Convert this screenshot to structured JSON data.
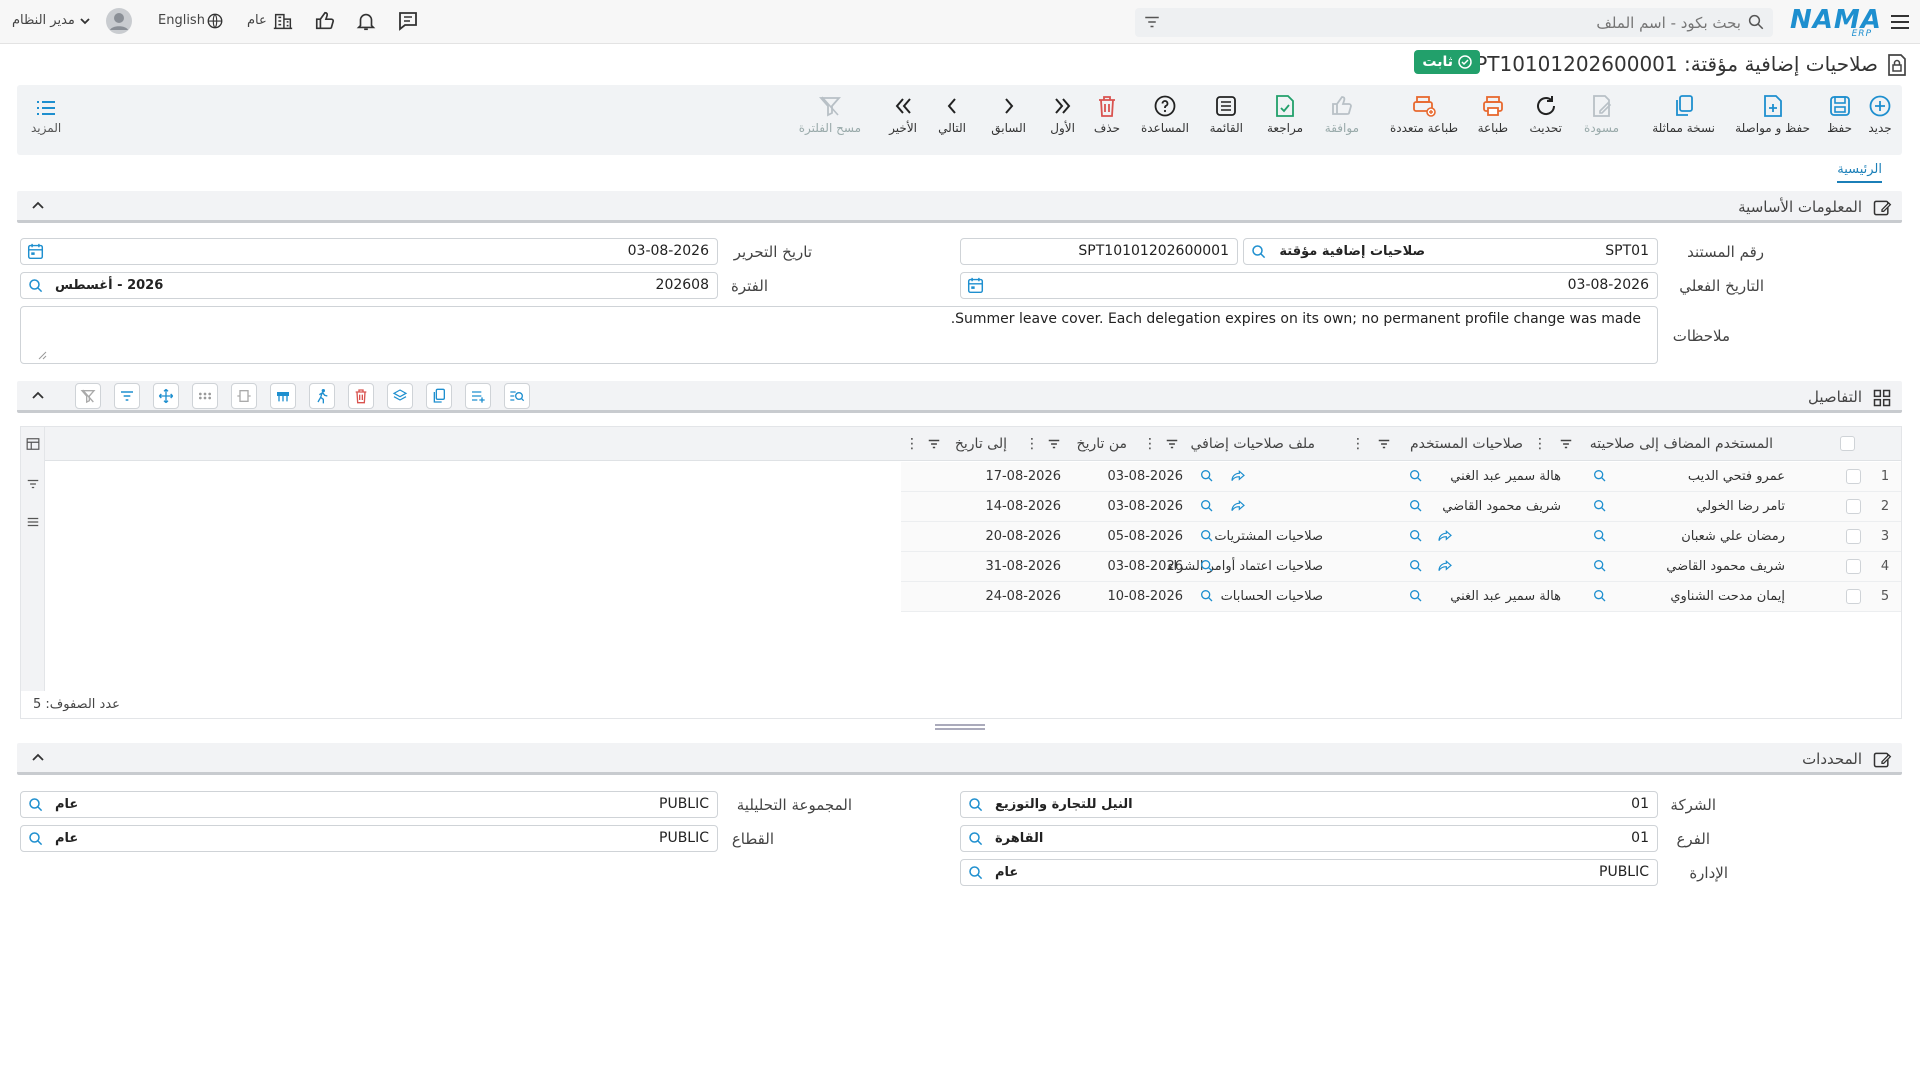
{
  "topbar": {
    "logo_text": "NAMA",
    "logo_sub": "ERP",
    "search_placeholder": "بحث بكود - اسم الملف",
    "user_name": "مدير النظام",
    "language": "English",
    "context": "عام"
  },
  "title": {
    "text": "صلاحيات إضافية مؤقتة: SPT10101202600001",
    "status": "ثابت"
  },
  "toolbar": {
    "buttons": [
      {
        "label": "جديد",
        "icon": "plus-circle-icon"
      },
      {
        "label": "حفظ",
        "icon": "save-icon"
      },
      {
        "label": "حفظ و مواصلة",
        "icon": "save-continue-icon"
      },
      {
        "label": "نسخة مماثلة",
        "icon": "copy-icon"
      },
      {
        "label": "مسودة",
        "icon": "draft-icon"
      },
      {
        "label": "تحديث",
        "icon": "refresh-icon"
      },
      {
        "label": "طباعة",
        "icon": "print-icon"
      },
      {
        "label": "طباعة متعددة",
        "icon": "multi-print-icon"
      },
      {
        "label": "موافقة",
        "icon": "approve-icon"
      },
      {
        "label": "مراجعة",
        "icon": "review-icon"
      },
      {
        "label": "القائمة",
        "icon": "list-icon"
      },
      {
        "label": "المساعدة",
        "icon": "help-icon"
      },
      {
        "label": "حذف",
        "icon": "delete-icon"
      },
      {
        "label": "الأول",
        "icon": "first-icon"
      },
      {
        "label": "السابق",
        "icon": "previous-icon"
      },
      {
        "label": "التالي",
        "icon": "next-icon"
      },
      {
        "label": "الأخير",
        "icon": "last-icon"
      },
      {
        "label": "مسح الفلترة",
        "icon": "clear-filter-icon"
      }
    ],
    "more_label": "المزيد"
  },
  "tabs": {
    "main": "الرئيسية"
  },
  "basic_info": {
    "title": "المعلومات الأساسية",
    "doc_number_label": "رقم المستند",
    "doc_code": "SPT01",
    "doc_type_name": "صلاحيات إضافية مؤقتة",
    "doc_number": "SPT10101202600001",
    "edit_date_label": "تاريخ التحرير",
    "edit_date": "03-08-2026",
    "actual_date_label": "التاريخ الفعلي",
    "actual_date": "03-08-2026",
    "period_label": "الفترة",
    "period_code": "202608",
    "period_name": "2026 - أغسطس",
    "notes_label": "ملاحظات",
    "notes": "Summer leave cover. Each delegation expires on its own; no permanent profile change was made."
  },
  "details": {
    "title": "التفاصيل",
    "columns": {
      "added_user": "المستخدم المضاف إلى صلاحيته",
      "user_perms": "صلاحيات المستخدم",
      "extra_file": "ملف صلاحيات إضافي",
      "from_date": "من تاريخ",
      "to_date": "إلى تاريخ"
    },
    "rows": [
      {
        "n": "1",
        "user": "عمرو فتحي الديب",
        "perm_user": "هالة سمير عبد الغني",
        "file": "",
        "from": "03-08-2026",
        "to": "17-08-2026"
      },
      {
        "n": "2",
        "user": "تامر رضا الخولي",
        "perm_user": "شريف محمود القاضي",
        "file": "",
        "from": "03-08-2026",
        "to": "14-08-2026"
      },
      {
        "n": "3",
        "user": "رمضان علي شعبان",
        "perm_user": "",
        "file": "صلاحيات المشتريات",
        "from": "05-08-2026",
        "to": "20-08-2026"
      },
      {
        "n": "4",
        "user": "شريف محمود القاضي",
        "perm_user": "",
        "file": "صلاحيات اعتماد أوامر الشراء",
        "from": "03-08-2026",
        "to": "31-08-2026"
      },
      {
        "n": "5",
        "user": "إيمان مدحت الشناوي",
        "perm_user": "هالة سمير عبد الغني",
        "file": "صلاحيات الحسابات",
        "from": "10-08-2026",
        "to": "24-08-2026"
      }
    ],
    "row_count_label": "عدد الصفوف: 5"
  },
  "determinants": {
    "title": "المحددات",
    "company_label": "الشركة",
    "company_code": "01",
    "company_name": "النيل للتجارة والتوزيع",
    "branch_label": "الفرع",
    "branch_code": "01",
    "branch_name": "القاهرة",
    "dept_label": "الإدارة",
    "dept_code": "PUBLIC",
    "dept_name": "عام",
    "analytic_label": "المجموعة التحليلية",
    "analytic_code": "PUBLIC",
    "analytic_name": "عام",
    "sector_label": "القطاع",
    "sector_code": "PUBLIC",
    "sector_name": "عام"
  },
  "colors": {
    "accent": "#1e8fcf",
    "status": "#22a06b",
    "danger": "#d9534f"
  }
}
